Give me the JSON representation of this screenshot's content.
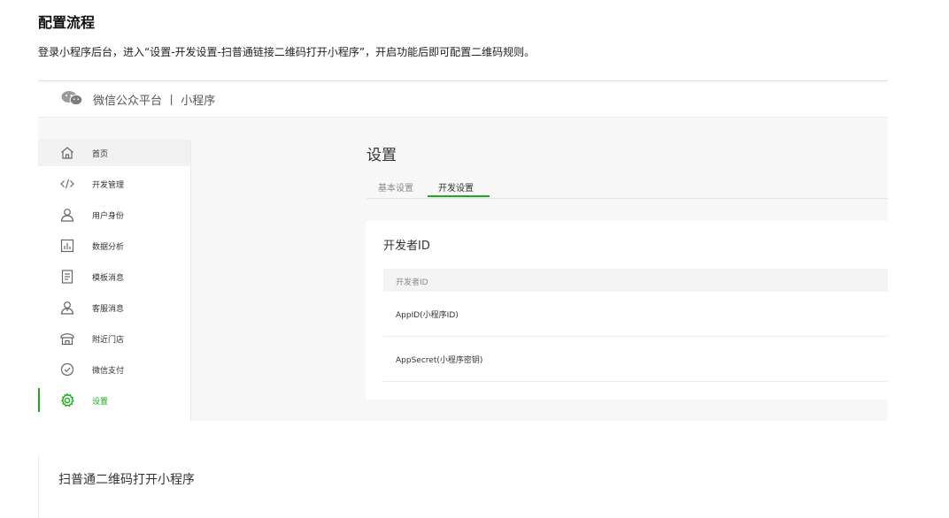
{
  "doc": {
    "title": "配置流程",
    "description": "登录小程序后台，进入“设置-开发设置-扫普通链接二维码打开小程序”，开启功能后即可配置二维码规则。"
  },
  "screenshot": {
    "brand": "微信公众平台 丨 小程序",
    "sidebar": {
      "items": [
        {
          "label": "首页",
          "icon": "home-icon"
        },
        {
          "label": "开发管理",
          "icon": "code-icon"
        },
        {
          "label": "用户身份",
          "icon": "user-icon"
        },
        {
          "label": "数据分析",
          "icon": "chart-icon"
        },
        {
          "label": "模板消息",
          "icon": "document-icon"
        },
        {
          "label": "客服消息",
          "icon": "customer-service-icon"
        },
        {
          "label": "附近门店",
          "icon": "store-icon"
        },
        {
          "label": "微信支付",
          "icon": "payment-icon"
        },
        {
          "label": "设置",
          "icon": "gear-icon"
        }
      ],
      "active_label": "设置"
    },
    "settings": {
      "title": "设置",
      "tabs": [
        {
          "label": "基本设置"
        },
        {
          "label": "开发设置"
        }
      ],
      "active_tab": "开发设置",
      "card": {
        "title": "开发者ID",
        "table_header": "开发者ID",
        "rows": [
          {
            "label": "AppID(小程序ID)"
          },
          {
            "label": "AppSecret(小程序密钥)"
          }
        ]
      }
    }
  },
  "section": {
    "title": "扫普通二维码打开小程序"
  },
  "colors": {
    "accent": "#1aad19",
    "sidebar_active_bg": "#f1f1f1",
    "page_bg": "#f7f7f7"
  }
}
